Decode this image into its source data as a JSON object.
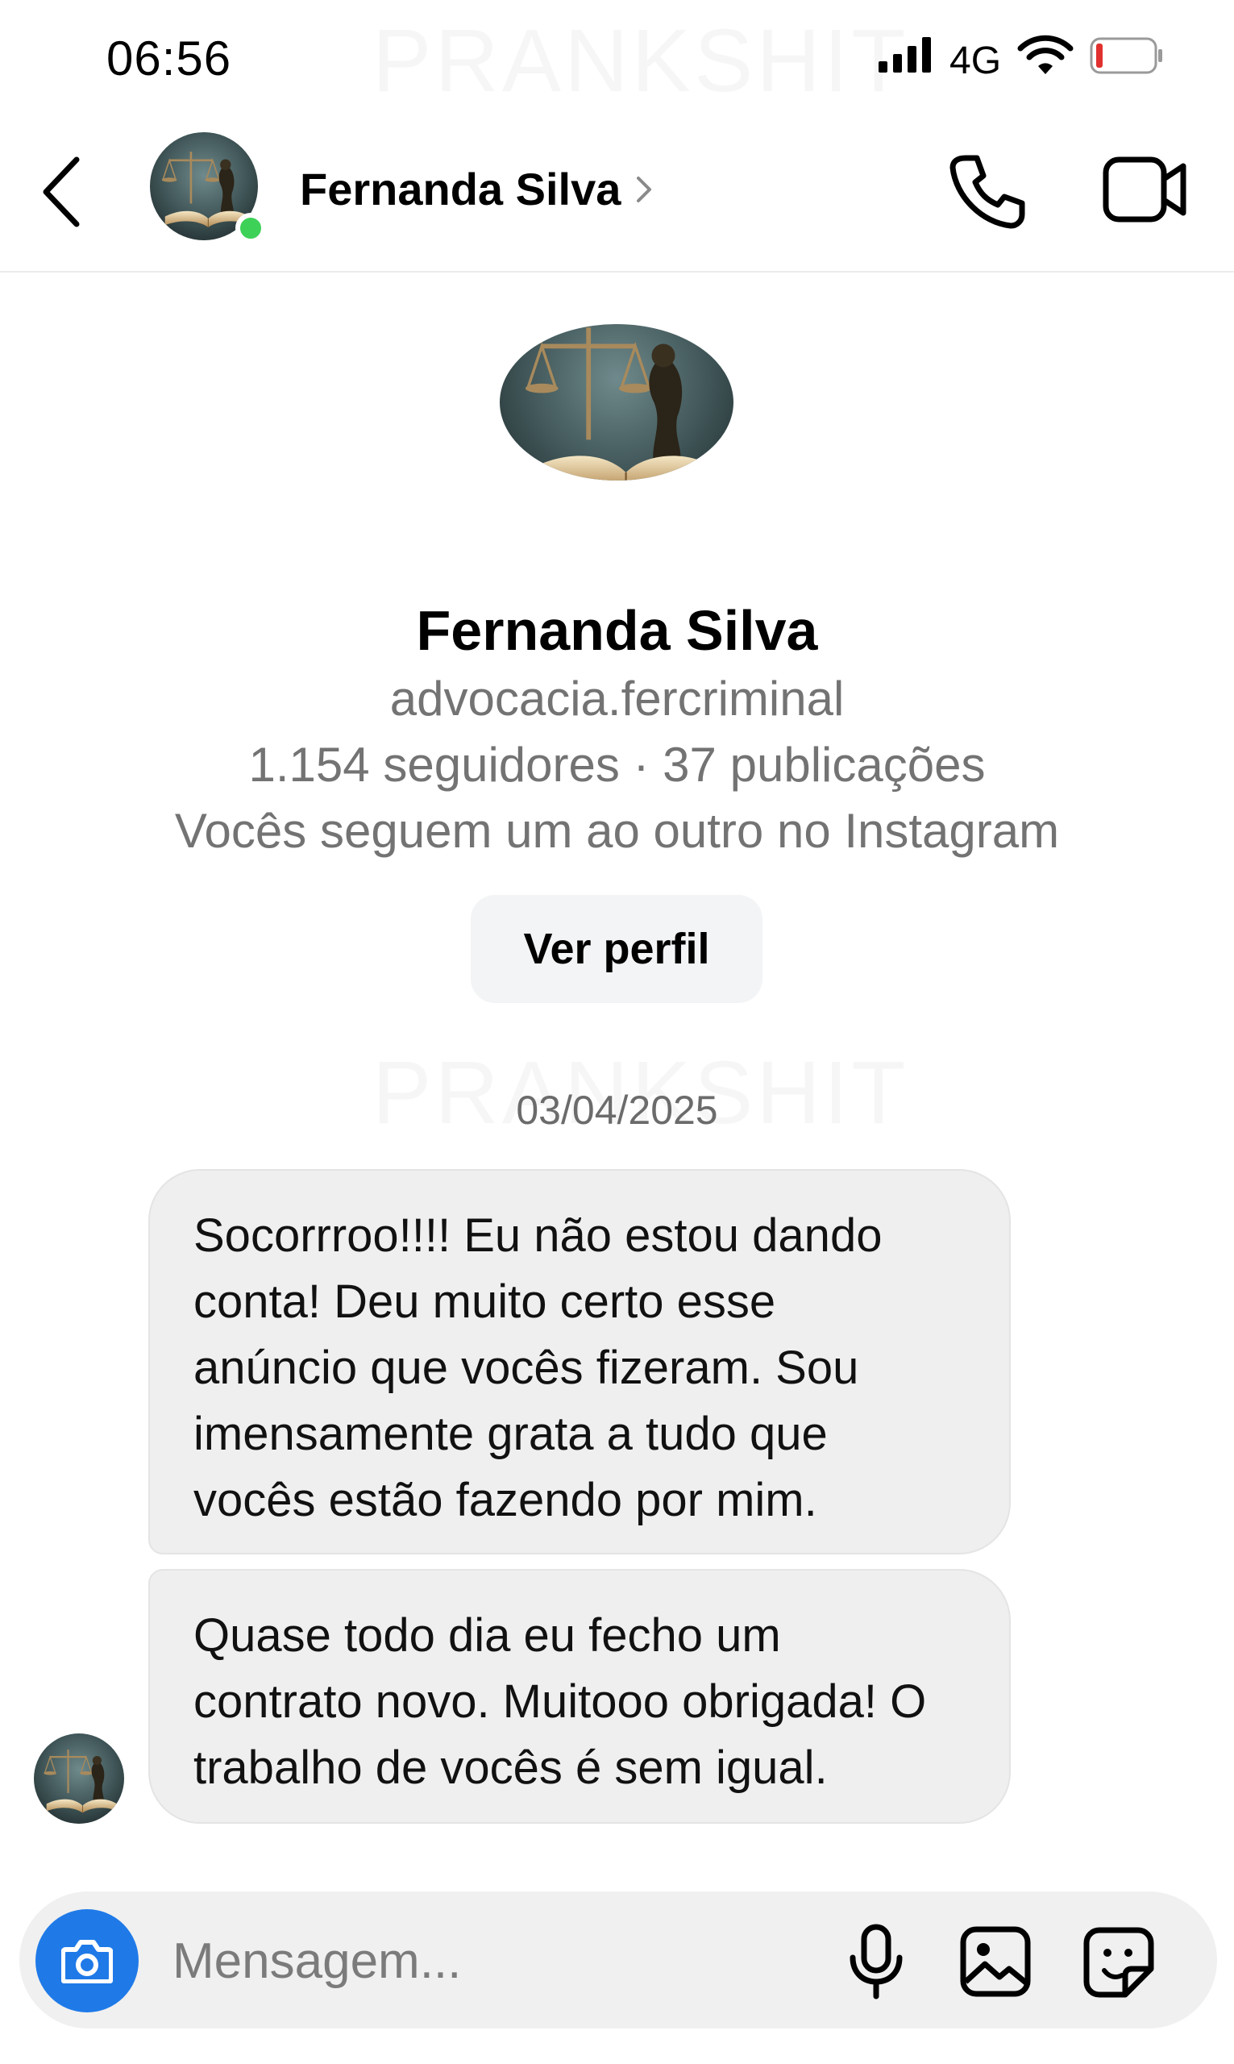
{
  "status_bar": {
    "time": "06:56",
    "network": "4G",
    "icons": [
      "signal-icon",
      "wifi-icon",
      "battery-low-icon"
    ],
    "battery_color": "#e0312f"
  },
  "watermark": "PRANKSHIT",
  "header": {
    "name": "Fernanda Silva",
    "online_color": "#3ed158",
    "icons": [
      "back-arrow-icon",
      "chevron-right-icon",
      "phone-icon",
      "video-camera-icon"
    ]
  },
  "profile": {
    "name": "Fernanda Silva",
    "username": "advocacia.fercriminal",
    "stats": "1.154 seguidores · 37 publicações",
    "mutual": "Vocês seguem um ao outro no Instagram",
    "button_label": "Ver perfil"
  },
  "conversation": {
    "date": "03/04/2025",
    "messages": [
      {
        "lines": [
          "Socorrroo!!!! Eu não estou dando",
          "conta! Deu muito certo esse",
          "anúncio que vocês fizeram. Sou",
          "imensamente grata a tudo que",
          "vocês estão fazendo por mim."
        ]
      },
      {
        "lines": [
          "Quase todo dia eu fecho um",
          "contrato novo. Muitooo obrigada! O",
          "trabalho de vocês é sem igual."
        ]
      }
    ]
  },
  "composer": {
    "placeholder": "Mensagem...",
    "value": "",
    "accent_color": "#1f7ae8",
    "icons": [
      "camera-icon",
      "microphone-icon",
      "gallery-icon",
      "sticker-icon"
    ]
  }
}
